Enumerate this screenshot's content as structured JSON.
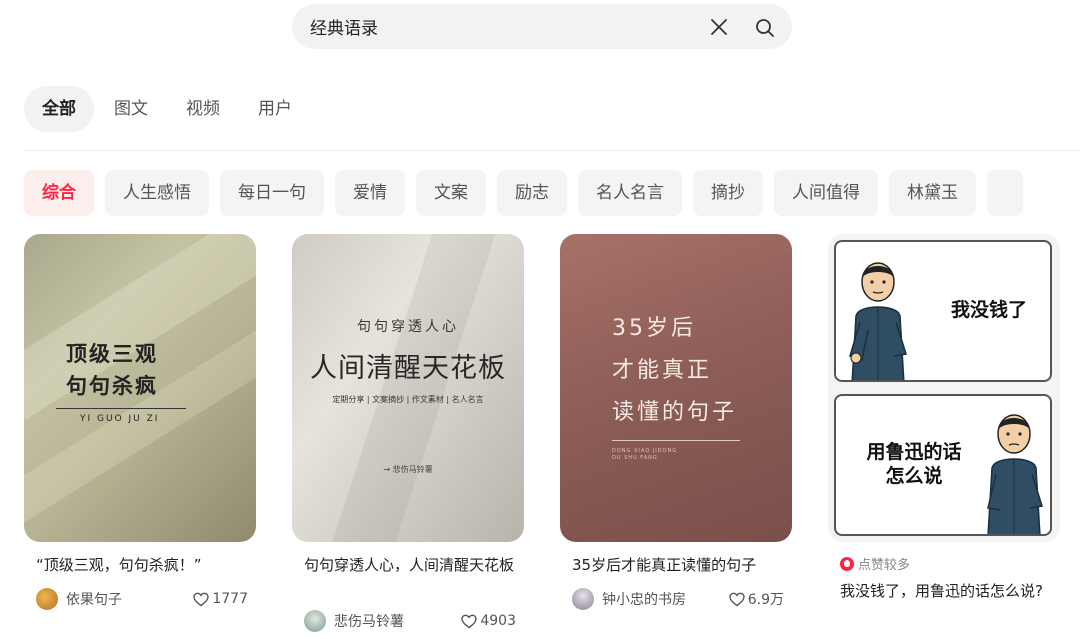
{
  "search": {
    "value": "经典语录",
    "placeholder": ""
  },
  "tabs": [
    {
      "label": "全部",
      "active": true
    },
    {
      "label": "图文",
      "active": false
    },
    {
      "label": "视频",
      "active": false
    },
    {
      "label": "用户",
      "active": false
    }
  ],
  "chips": [
    {
      "label": "综合",
      "active": true
    },
    {
      "label": "人生感悟"
    },
    {
      "label": "每日一句"
    },
    {
      "label": "爱情"
    },
    {
      "label": "文案"
    },
    {
      "label": "励志"
    },
    {
      "label": "名人名言"
    },
    {
      "label": "摘抄"
    },
    {
      "label": "人间值得"
    },
    {
      "label": "林黛玉"
    },
    {
      "label": ""
    }
  ],
  "cards": [
    {
      "cover": {
        "line1": "顶级三观",
        "line2": "句句杀疯",
        "sub": "YI GUO JU ZI"
      },
      "title": "“顶级三观，句句杀疯！”",
      "author": "依果句子",
      "likes": "1777"
    },
    {
      "cover": {
        "line1": "句句穿透人心",
        "line2": "人间清醒天花板",
        "line3": "定期分享 | 文案摘抄 | 作文素材 | 名人名言",
        "line4": "→ 悲伤马铃薯"
      },
      "title": "句句穿透人心，人间清醒天花板",
      "author": "悲伤马铃薯",
      "likes": "4903"
    },
    {
      "cover": {
        "line1": "35岁后",
        "line2": "才能真正",
        "line3": "读懂的句子",
        "sub": "DONG XIAO JIDONG\nDU SHU FANG"
      },
      "title": "35岁后才能真正读懂的句子",
      "author": "钟小忠的书房",
      "likes": "6.9万"
    },
    {
      "cover": {
        "panel1": "我没钱了",
        "panel2_line1": "用鲁迅的话",
        "panel2_line2": "怎么说"
      },
      "badge": "点赞较多",
      "title": "我没钱了，用鲁迅的话怎么说?"
    }
  ],
  "colors": {
    "accent": "#ff2442",
    "chip_bg": "#f4f4f4",
    "tab_active_bg": "#f2f2f2"
  }
}
